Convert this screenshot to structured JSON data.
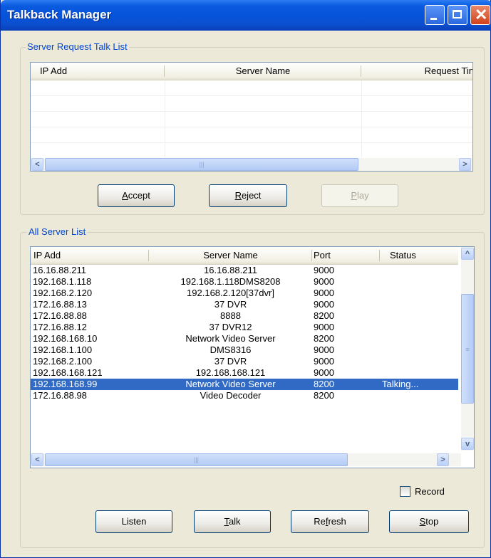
{
  "window": {
    "title": "Talkback Manager"
  },
  "request_group": {
    "title": "Server Request Talk List",
    "columns": [
      "IP Add",
      "Server Name",
      "Request Tin"
    ],
    "buttons": {
      "accept": {
        "pre": "",
        "key": "A",
        "post": "ccept"
      },
      "reject": {
        "pre": "",
        "key": "R",
        "post": "eject"
      },
      "play": {
        "pre": "",
        "key": "P",
        "post": "lay"
      }
    }
  },
  "server_group": {
    "title": "All Server List",
    "columns": [
      "IP Add",
      "Server Name",
      "Port",
      "Status"
    ],
    "rows": [
      {
        "ip": "16.16.88.211",
        "name": "16.16.88.211",
        "port": "9000",
        "status": ""
      },
      {
        "ip": "192.168.1.118",
        "name": "192.168.1.118DMS8208",
        "port": "9000",
        "status": ""
      },
      {
        "ip": "192.168.2.120",
        "name": "192.168.2.120[37dvr]",
        "port": "9000",
        "status": ""
      },
      {
        "ip": "172.16.88.13",
        "name": "37 DVR",
        "port": "9000",
        "status": ""
      },
      {
        "ip": "172.16.88.88",
        "name": "8888",
        "port": "8200",
        "status": ""
      },
      {
        "ip": "172.16.88.12",
        "name": "37 DVR12",
        "port": "9000",
        "status": ""
      },
      {
        "ip": "192.168.168.10",
        "name": "Network Video Server",
        "port": "8200",
        "status": ""
      },
      {
        "ip": "192.168.1.100",
        "name": "DMS8316",
        "port": "9000",
        "status": ""
      },
      {
        "ip": "192.168.2.100",
        "name": "37 DVR",
        "port": "9000",
        "status": ""
      },
      {
        "ip": "192.168.168.121",
        "name": "192.168.168.121",
        "port": "9000",
        "status": ""
      },
      {
        "ip": "192.168.168.99",
        "name": "Network Video Server",
        "port": "8200",
        "status": "Talking..."
      },
      {
        "ip": "172.16.88.98",
        "name": "Video Decoder",
        "port": "8200",
        "status": ""
      }
    ],
    "selected_ip": "192.168.168.99"
  },
  "record": {
    "pre": "Re",
    "key": "c",
    "post": "ord",
    "checked": false
  },
  "bottom_buttons": {
    "listen": {
      "pre": "Listen",
      "key": "",
      "post": ""
    },
    "talk": {
      "pre": "",
      "key": "T",
      "post": "alk"
    },
    "refresh": {
      "pre": "Re",
      "key": "f",
      "post": "resh"
    },
    "stop": {
      "pre": "",
      "key": "S",
      "post": "top"
    }
  },
  "colors": {
    "title_bar": "#0653d8",
    "selection": "#316ac5",
    "group_title": "#0046d5"
  },
  "icons": {
    "minimize": "minimize-icon",
    "maximize": "maximize-icon",
    "close": "close-icon"
  }
}
